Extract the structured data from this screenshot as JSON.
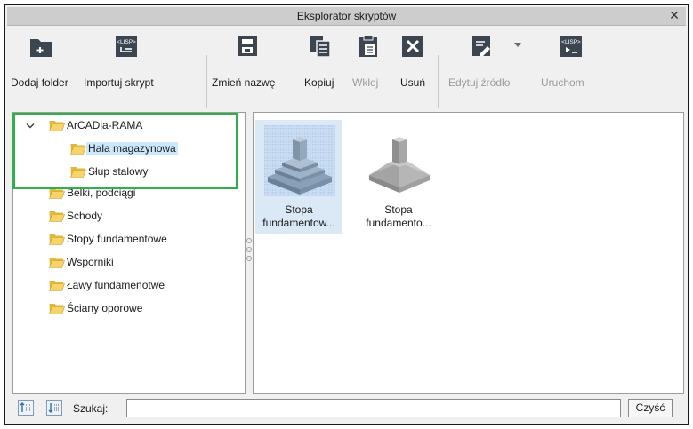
{
  "window": {
    "title": "Eksplorator skryptów",
    "close_glyph": "✕"
  },
  "toolbar": {
    "items": [
      {
        "label": "Dodaj folder",
        "icon": "add-folder-icon",
        "enabled": true
      },
      {
        "label": "Importuj skrypt",
        "icon": "import-lisp-icon",
        "enabled": true
      },
      {
        "label": "Zmień nazwę",
        "icon": "rename-icon",
        "enabled": true
      },
      {
        "label": "Kopiuj",
        "icon": "copy-icon",
        "enabled": true
      },
      {
        "label": "Wklej",
        "icon": "paste-icon",
        "enabled": false
      },
      {
        "label": "Usuń",
        "icon": "delete-icon",
        "enabled": true
      },
      {
        "label": "Edytuj źródło",
        "icon": "edit-source-icon",
        "enabled": false
      },
      {
        "label": "Uruchom",
        "icon": "run-lisp-icon",
        "enabled": false
      }
    ]
  },
  "tree": {
    "root": {
      "label": "ArCADia-RAMA",
      "expanded": true
    },
    "children": [
      {
        "label": "Hala magazynowa",
        "selected": true
      },
      {
        "label": "Słup stalowy",
        "selected": false
      }
    ],
    "folders": [
      {
        "label": "Belki, podciągi"
      },
      {
        "label": "Schody"
      },
      {
        "label": "Stopy fundamentowe"
      },
      {
        "label": "Wsporniki"
      },
      {
        "label": "Ławy fundamenotwe"
      },
      {
        "label": "Ściany oporowe"
      }
    ]
  },
  "files": [
    {
      "line1": "Stopa",
      "line2": "fundamentow...",
      "selected": true,
      "icon": "stepped-footing-icon"
    },
    {
      "line1": "Stopa",
      "line2": "fundamento...",
      "selected": false,
      "icon": "sloped-footing-icon"
    }
  ],
  "search": {
    "label": "Szukaj:",
    "value": "",
    "placeholder": "",
    "clear_label": "Czyść"
  },
  "colors": {
    "selection": "#cce8ff",
    "highlight_box": "#2eb04a",
    "folder": "#f2c94c"
  }
}
